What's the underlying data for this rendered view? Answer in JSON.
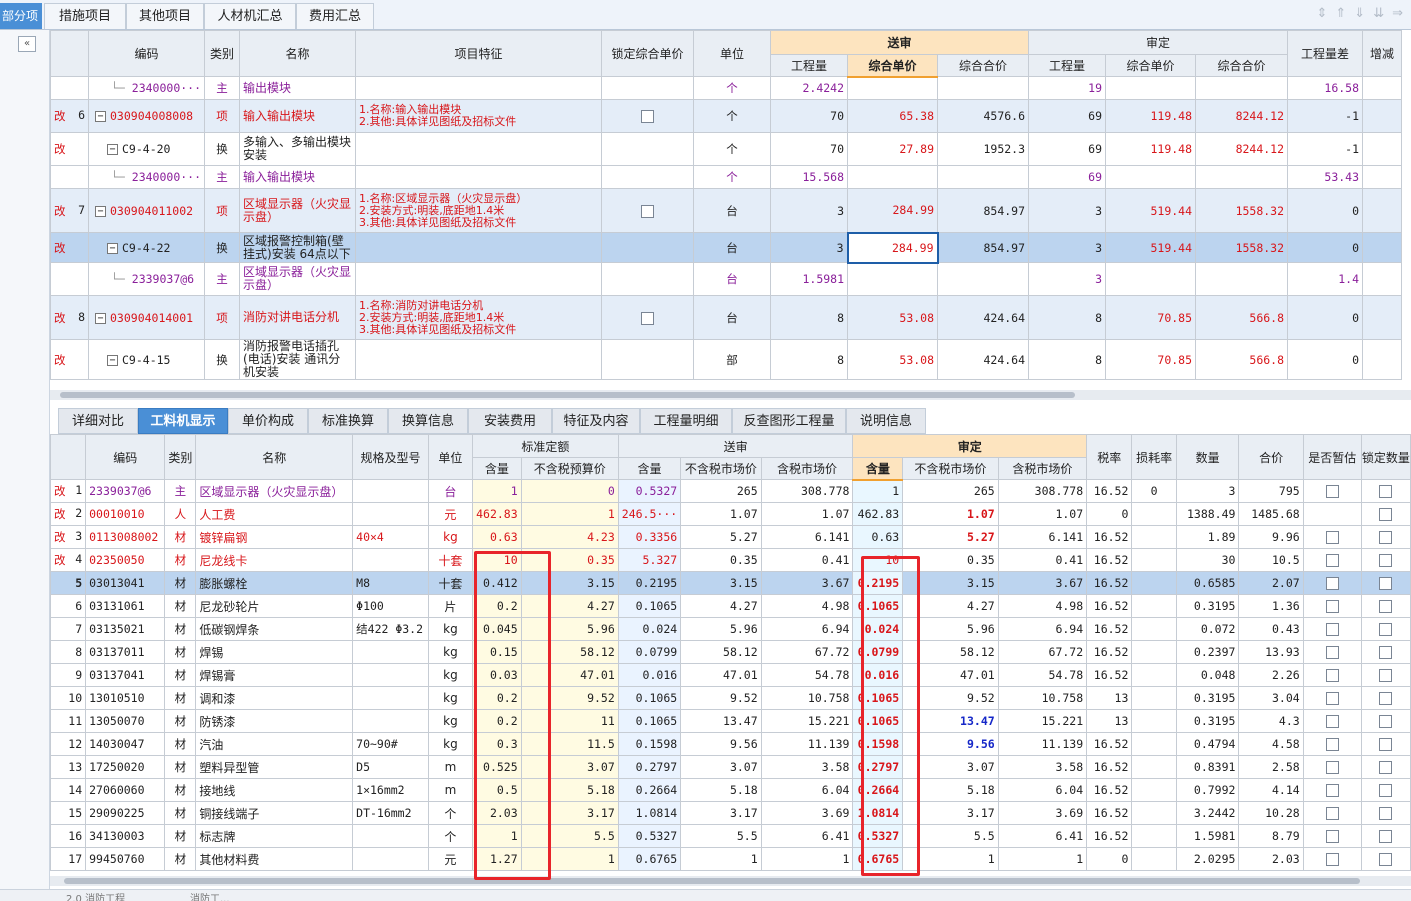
{
  "top_tabs": {
    "left_partial": "部分项",
    "items": [
      "措施项目",
      "其他项目",
      "人材机汇总",
      "费用汇总"
    ]
  },
  "upper_grid": {
    "headers": {
      "code": "编码",
      "type": "类别",
      "name": "名称",
      "feature": "项目特征",
      "lock": "锁定综合单价",
      "unit": "单位",
      "group_send": "送审",
      "group_audit": "审定",
      "qty": "工程量",
      "unit_price": "综合单价",
      "total": "综合合价",
      "diff": "工程量差",
      "extra": "增减"
    },
    "rows": [
      {
        "mark": "",
        "idx": "",
        "code": "2340000···",
        "type": "主",
        "name": "输出模块",
        "feature": "",
        "unit": "个",
        "s_qty": "2.4242",
        "s_price": "",
        "s_total": "",
        "a_qty": "19",
        "a_price": "",
        "a_total": "",
        "diff": "16.58"
      },
      {
        "mark": "改",
        "idx": "6",
        "code": "030904008008",
        "type": "项",
        "name": "输入输出模块",
        "feature": "1.名称:输入输出模块\n2.其他:具体详见图纸及招标文件",
        "unit": "个",
        "s_qty": "70",
        "s_price": "65.38",
        "s_total": "4576.6",
        "a_qty": "69",
        "a_price": "119.48",
        "a_total": "8244.12",
        "diff": "-1"
      },
      {
        "mark": "改",
        "idx": "",
        "code": "C9-4-20",
        "type": "换",
        "name": "多输入、多输出模块安装",
        "feature": "",
        "unit": "个",
        "s_qty": "70",
        "s_price": "27.89",
        "s_total": "1952.3",
        "a_qty": "69",
        "a_price": "119.48",
        "a_total": "8244.12",
        "diff": "-1"
      },
      {
        "mark": "",
        "idx": "",
        "code": "2340000···",
        "type": "主",
        "name": "输入输出模块",
        "feature": "",
        "unit": "个",
        "s_qty": "15.568",
        "s_price": "",
        "s_total": "",
        "a_qty": "69",
        "a_price": "",
        "a_total": "",
        "diff": "53.43"
      },
      {
        "mark": "改",
        "idx": "7",
        "code": "030904011002",
        "type": "项",
        "name": "区域显示器（火灾显示盘）",
        "feature": "1.名称:区域显示器（火灾显示盘）\n2.安装方式:明装,底距地1.4米\n3.其他:具体详见图纸及招标文件",
        "unit": "台",
        "s_qty": "3",
        "s_price": "284.99",
        "s_total": "854.97",
        "a_qty": "3",
        "a_price": "519.44",
        "a_total": "1558.32",
        "diff": "0"
      },
      {
        "mark": "改",
        "idx": "",
        "code": "C9-4-22",
        "type": "换",
        "name": "区域报警控制箱(壁挂式)安装 64点以下",
        "feature": "",
        "unit": "台",
        "s_qty": "3",
        "s_price": "284.99",
        "s_total": "854.97",
        "a_qty": "3",
        "a_price": "519.44",
        "a_total": "1558.32",
        "diff": "0"
      },
      {
        "mark": "",
        "idx": "",
        "code": "2339037@6",
        "type": "主",
        "name": "区域显示器（火灾显示盘）",
        "feature": "",
        "unit": "台",
        "s_qty": "1.5981",
        "s_price": "",
        "s_total": "",
        "a_qty": "3",
        "a_price": "",
        "a_total": "",
        "diff": "1.4"
      },
      {
        "mark": "改",
        "idx": "8",
        "code": "030904014001",
        "type": "项",
        "name": "消防对讲电话分机",
        "feature": "1.名称:消防对讲电话分机\n2.安装方式:明装,底距地1.4米\n3.其他:具体详见图纸及招标文件",
        "unit": "台",
        "s_qty": "8",
        "s_price": "53.08",
        "s_total": "424.64",
        "a_qty": "8",
        "a_price": "70.85",
        "a_total": "566.8",
        "diff": "0"
      },
      {
        "mark": "改",
        "idx": "",
        "code": "C9-4-15",
        "type": "换",
        "name": "消防报警电话插孔(电话)安装 通讯分机安装",
        "feature": "",
        "unit": "部",
        "s_qty": "8",
        "s_price": "53.08",
        "s_total": "424.64",
        "a_qty": "8",
        "a_price": "70.85",
        "a_total": "566.8",
        "diff": "0"
      }
    ]
  },
  "lower_tabs": [
    "详细对比",
    "工料机显示",
    "单价构成",
    "标准换算",
    "换算信息",
    "安装费用",
    "特征及内容",
    "工程量明细",
    "反查图形工程量",
    "说明信息"
  ],
  "lower_grid": {
    "headers": {
      "code": "编码",
      "type": "类别",
      "name": "名称",
      "spec": "规格及型号",
      "unit": "单位",
      "group_std": "标准定额",
      "group_send": "送审",
      "group_audit": "审定",
      "content": "含量",
      "pre_tax_budget": "不含税预算价",
      "pre_tax_market": "不含税市场价",
      "tax_market": "含税市场价",
      "tax_rate": "税率",
      "loss_rate": "损耗率",
      "quantity": "数量",
      "total": "合价",
      "provisional": "是否暂估",
      "lock_qty": "锁定数量"
    },
    "rows": [
      {
        "mark": "改",
        "idx": "1",
        "code": "2339037@6",
        "type": "主",
        "name": "区域显示器（火灾显示盘）",
        "spec": "",
        "unit": "台",
        "std_c": "1",
        "std_p": "0",
        "s_c": "0.5327",
        "s_p": "265",
        "s_t": "308.778",
        "a_c": "1",
        "a_p": "265",
        "a_t": "308.778",
        "tax": "16.52",
        "loss": "0",
        "qty": "3",
        "total": "795"
      },
      {
        "mark": "改",
        "idx": "2",
        "code": "00010010",
        "type": "人",
        "name": "人工费",
        "spec": "",
        "unit": "元",
        "std_c": "462.83",
        "std_p": "1",
        "s_c": "246.5···",
        "s_p": "1.07",
        "s_t": "1.07",
        "a_c": "462.83",
        "a_p": "1.07",
        "a_t": "1.07",
        "tax": "0",
        "loss": "",
        "qty": "1388.49",
        "total": "1485.68"
      },
      {
        "mark": "改",
        "idx": "3",
        "code": "0113008002",
        "type": "材",
        "name": "镀锌扁钢",
        "spec": "40×4",
        "unit": "kg",
        "std_c": "0.63",
        "std_p": "4.23",
        "s_c": "0.3356",
        "s_p": "5.27",
        "s_t": "6.141",
        "a_c": "0.63",
        "a_p": "5.27",
        "a_t": "6.141",
        "tax": "16.52",
        "loss": "",
        "qty": "1.89",
        "total": "9.96"
      },
      {
        "mark": "改",
        "idx": "4",
        "code": "02350050",
        "type": "材",
        "name": "尼龙线卡",
        "spec": "",
        "unit": "十套",
        "std_c": "10",
        "std_p": "0.35",
        "s_c": "5.327",
        "s_p": "0.35",
        "s_t": "0.41",
        "a_c": "10",
        "a_p": "0.35",
        "a_t": "0.41",
        "tax": "16.52",
        "loss": "",
        "qty": "30",
        "total": "10.5"
      },
      {
        "mark": "",
        "idx": "5",
        "code": "03013041",
        "type": "材",
        "name": "膨胀螺栓",
        "spec": "M8",
        "unit": "十套",
        "std_c": "0.412",
        "std_p": "3.15",
        "s_c": "0.2195",
        "s_p": "3.15",
        "s_t": "3.67",
        "a_c": "0.2195",
        "a_p": "3.15",
        "a_t": "3.67",
        "tax": "16.52",
        "loss": "",
        "qty": "0.6585",
        "total": "2.07"
      },
      {
        "mark": "",
        "idx": "6",
        "code": "03131061",
        "type": "材",
        "name": "尼龙砂轮片",
        "spec": "Φ100",
        "unit": "片",
        "std_c": "0.2",
        "std_p": "4.27",
        "s_c": "0.1065",
        "s_p": "4.27",
        "s_t": "4.98",
        "a_c": "0.1065",
        "a_p": "4.27",
        "a_t": "4.98",
        "tax": "16.52",
        "loss": "",
        "qty": "0.3195",
        "total": "1.36"
      },
      {
        "mark": "",
        "idx": "7",
        "code": "03135021",
        "type": "材",
        "name": "低碳钢焊条",
        "spec": "结422 Φ3.2",
        "unit": "kg",
        "std_c": "0.045",
        "std_p": "5.96",
        "s_c": "0.024",
        "s_p": "5.96",
        "s_t": "6.94",
        "a_c": "0.024",
        "a_p": "5.96",
        "a_t": "6.94",
        "tax": "16.52",
        "loss": "",
        "qty": "0.072",
        "total": "0.43"
      },
      {
        "mark": "",
        "idx": "8",
        "code": "03137011",
        "type": "材",
        "name": "焊锡",
        "spec": "",
        "unit": "kg",
        "std_c": "0.15",
        "std_p": "58.12",
        "s_c": "0.0799",
        "s_p": "58.12",
        "s_t": "67.72",
        "a_c": "0.0799",
        "a_p": "58.12",
        "a_t": "67.72",
        "tax": "16.52",
        "loss": "",
        "qty": "0.2397",
        "total": "13.93"
      },
      {
        "mark": "",
        "idx": "9",
        "code": "03137041",
        "type": "材",
        "name": "焊锡膏",
        "spec": "",
        "unit": "kg",
        "std_c": "0.03",
        "std_p": "47.01",
        "s_c": "0.016",
        "s_p": "47.01",
        "s_t": "54.78",
        "a_c": "0.016",
        "a_p": "47.01",
        "a_t": "54.78",
        "tax": "16.52",
        "loss": "",
        "qty": "0.048",
        "total": "2.26"
      },
      {
        "mark": "",
        "idx": "10",
        "code": "13010510",
        "type": "材",
        "name": "调和漆",
        "spec": "",
        "unit": "kg",
        "std_c": "0.2",
        "std_p": "9.52",
        "s_c": "0.1065",
        "s_p": "9.52",
        "s_t": "10.758",
        "a_c": "0.1065",
        "a_p": "9.52",
        "a_t": "10.758",
        "tax": "13",
        "loss": "",
        "qty": "0.3195",
        "total": "3.04"
      },
      {
        "mark": "",
        "idx": "11",
        "code": "13050070",
        "type": "材",
        "name": "防锈漆",
        "spec": "",
        "unit": "kg",
        "std_c": "0.2",
        "std_p": "11",
        "s_c": "0.1065",
        "s_p": "13.47",
        "s_t": "15.221",
        "a_c": "0.1065",
        "a_p": "13.47",
        "a_t": "15.221",
        "tax": "13",
        "loss": "",
        "qty": "0.3195",
        "total": "4.3"
      },
      {
        "mark": "",
        "idx": "12",
        "code": "14030047",
        "type": "材",
        "name": "汽油",
        "spec": "70~90#",
        "unit": "kg",
        "std_c": "0.3",
        "std_p": "11.5",
        "s_c": "0.1598",
        "s_p": "9.56",
        "s_t": "11.139",
        "a_c": "0.1598",
        "a_p": "9.56",
        "a_t": "11.139",
        "tax": "16.52",
        "loss": "",
        "qty": "0.4794",
        "total": "4.58"
      },
      {
        "mark": "",
        "idx": "13",
        "code": "17250020",
        "type": "材",
        "name": "塑料异型管",
        "spec": "D5",
        "unit": "m",
        "std_c": "0.525",
        "std_p": "3.07",
        "s_c": "0.2797",
        "s_p": "3.07",
        "s_t": "3.58",
        "a_c": "0.2797",
        "a_p": "3.07",
        "a_t": "3.58",
        "tax": "16.52",
        "loss": "",
        "qty": "0.8391",
        "total": "2.58"
      },
      {
        "mark": "",
        "idx": "14",
        "code": "27060060",
        "type": "材",
        "name": "接地线",
        "spec": "1×16mm2",
        "unit": "m",
        "std_c": "0.5",
        "std_p": "5.18",
        "s_c": "0.2664",
        "s_p": "5.18",
        "s_t": "6.04",
        "a_c": "0.2664",
        "a_p": "5.18",
        "a_t": "6.04",
        "tax": "16.52",
        "loss": "",
        "qty": "0.7992",
        "total": "4.14"
      },
      {
        "mark": "",
        "idx": "15",
        "code": "29090225",
        "type": "材",
        "name": "铜接线端子",
        "spec": "DT-16mm2",
        "unit": "个",
        "std_c": "2.03",
        "std_p": "3.17",
        "s_c": "1.0814",
        "s_p": "3.17",
        "s_t": "3.69",
        "a_c": "1.0814",
        "a_p": "3.17",
        "a_t": "3.69",
        "tax": "16.52",
        "loss": "",
        "qty": "3.2442",
        "total": "10.28"
      },
      {
        "mark": "",
        "idx": "16",
        "code": "34130003",
        "type": "材",
        "name": "标志牌",
        "spec": "",
        "unit": "个",
        "std_c": "1",
        "std_p": "5.5",
        "s_c": "0.5327",
        "s_p": "5.5",
        "s_t": "6.41",
        "a_c": "0.5327",
        "a_p": "5.5",
        "a_t": "6.41",
        "tax": "16.52",
        "loss": "",
        "qty": "1.5981",
        "total": "8.79"
      },
      {
        "mark": "",
        "idx": "17",
        "code": "99450760",
        "type": "材",
        "name": "其他材料费",
        "spec": "",
        "unit": "元",
        "std_c": "1.27",
        "std_p": "1",
        "s_c": "0.6765",
        "s_p": "1",
        "s_t": "1",
        "a_c": "0.6765",
        "a_p": "1",
        "a_t": "1",
        "tax": "0",
        "loss": "",
        "qty": "2.0295",
        "total": "2.03"
      }
    ]
  },
  "status_bar": [
    "2.0 消防工程",
    "消防工..."
  ]
}
